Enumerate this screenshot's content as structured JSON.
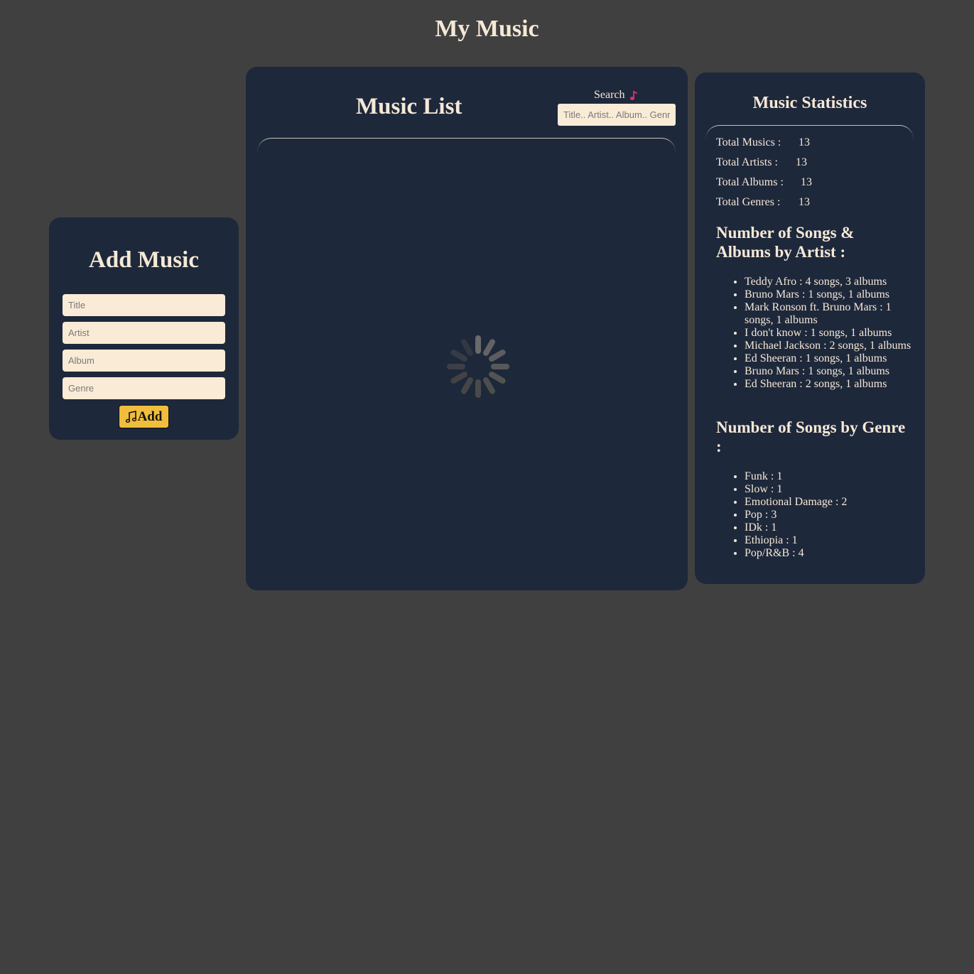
{
  "app": {
    "title": "My Music"
  },
  "add_music": {
    "heading": "Add Music",
    "title_placeholder": "Title",
    "artist_placeholder": "Artist",
    "album_placeholder": "Album",
    "genre_placeholder": "Genre",
    "add_label": "Add",
    "add_icon": "music-note-icon"
  },
  "music_list": {
    "heading": "Music List",
    "search_label": "Search",
    "search_icon": "music-note-icon",
    "search_placeholder": "Title.. Artist.. Album.. Genre",
    "loading_icon": "loading-spinner-icon"
  },
  "statistics": {
    "heading": "Music Statistics",
    "totals": [
      {
        "label": "Total Musics :",
        "value": "13"
      },
      {
        "label": "Total Artists :",
        "value": "13"
      },
      {
        "label": "Total Albums :",
        "value": "13"
      },
      {
        "label": "Total Genres :",
        "value": "13"
      }
    ],
    "by_artist_heading": "Number of Songs & Albums by Artist :",
    "by_artist": [
      "Teddy Afro : 4 songs, 3 albums",
      "Bruno Mars : 1 songs, 1 albums",
      "Mark Ronson ft. Bruno Mars : 1 songs, 1 albums",
      "I don't know : 1 songs, 1 albums",
      "Michael Jackson : 2 songs, 1 albums",
      "Ed Sheeran : 1 songs, 1 albums",
      "Bruno Mars : 1 songs, 1 albums",
      "Ed Sheeran : 2 songs, 1 albums"
    ],
    "by_genre_heading": "Number of Songs by Genre :",
    "by_genre": [
      "Funk : 1",
      "Slow : 1",
      "Emotional Damage : 2",
      "Pop : 3",
      "IDk : 1",
      "Ethiopia : 1",
      "Pop/R&B : 4"
    ]
  },
  "colors": {
    "page_bg": "#404040",
    "panel_bg": "#1e283b",
    "text": "#f5e8d6",
    "input_bg": "#faebd7",
    "button_bg": "#f0bd3c",
    "accent_note": "#e0306a"
  }
}
